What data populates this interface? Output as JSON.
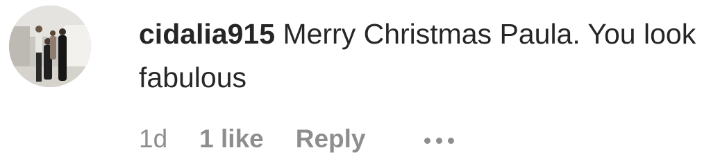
{
  "comment": {
    "username": "cidalia915",
    "text": "Merry Christmas Paula. You look fabulous",
    "timestamp": "1d",
    "likes": "1 like",
    "reply_label": "Reply",
    "more_icon": "more-options-icon",
    "avatar_icon": "user-avatar-photo"
  }
}
